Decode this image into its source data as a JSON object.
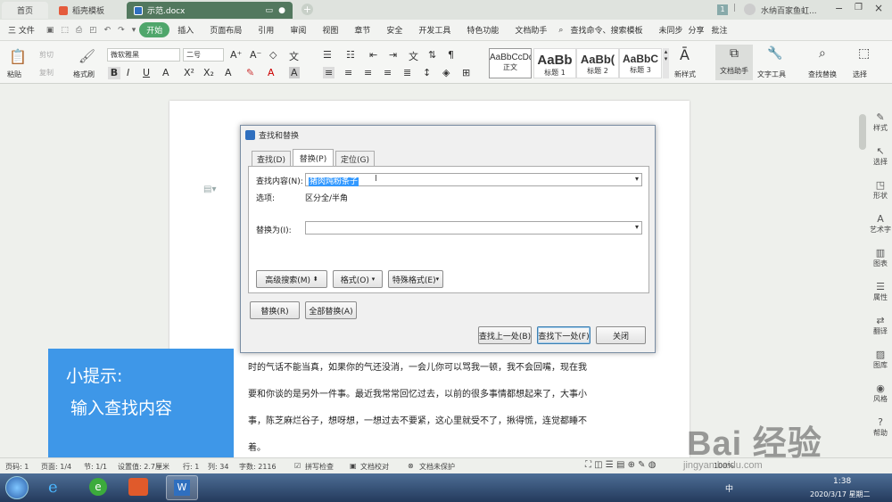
{
  "titlebar": {
    "tabs": [
      {
        "label": "首页"
      },
      {
        "label": "稻壳模板"
      },
      {
        "label": "示范.docx"
      }
    ],
    "user": "水纳百家鱼虹...",
    "badge": "1"
  },
  "menubar": {
    "file": "三 文件",
    "items": [
      "开始",
      "插入",
      "页面布局",
      "引用",
      "审阅",
      "视图",
      "章节",
      "安全",
      "开发工具",
      "特色功能",
      "文档助手"
    ],
    "active": "开始",
    "search": "查找命令、搜索模板",
    "sync": "未同步",
    "share": "分享",
    "comment": "批注"
  },
  "ribbon": {
    "paste": "粘贴",
    "cut": "剪切",
    "copy": "复制",
    "format_painter": "格式刷",
    "font_name": "微软雅黑",
    "font_size": "二号",
    "styles": [
      {
        "sample": "AaBbCcDd",
        "name": "正文"
      },
      {
        "sample": "AaBb",
        "name": "标题 1"
      },
      {
        "sample": "AaBb(",
        "name": "标题 2"
      },
      {
        "sample": "AaBbC",
        "name": "标题 3"
      }
    ],
    "new_style": "新样式",
    "doc_assistant": "文档助手",
    "text_tools": "文字工具",
    "find_replace": "查找替换",
    "select": "选择"
  },
  "dialog": {
    "title": "查找和替换",
    "tabs": [
      "查找(D)",
      "替换(P)",
      "定位(G)"
    ],
    "selected_tab": "替换(P)",
    "find_label": "查找内容(N):",
    "find_value": "猪肉炖粉条子",
    "options_label": "选项:",
    "options_value": "区分全/半角",
    "replace_label": "替换为(I):",
    "replace_value": "",
    "advanced": "高级搜索(M)",
    "format": "格式(O)",
    "special": "特殊格式(E)",
    "replace_btn": "替换(R)",
    "replace_all": "全部替换(A)",
    "find_prev": "查找上一处(B)",
    "find_next": "查找下一处(F)",
    "close": "关闭"
  },
  "document": {
    "lines": [
      "时的气话不能当真，如果你的气还没消，一会儿你可以骂我一顿，我不会回嘴，现在我",
      "要和你谈的是另外一件事。最近我常常回忆过去，以前的很多事情都想起来了，大事小",
      "事，陈芝麻烂谷子，想呀想，一想过去不要紧，这心里就受不了，揪得慌，连觉都睡不",
      "着。"
    ]
  },
  "tip": {
    "title": "小提示:",
    "body": "输入查找内容"
  },
  "rail": [
    "样式",
    "选择",
    "形状",
    "艺术字",
    "图表",
    "属性",
    "翻译",
    "图库",
    "风格",
    "帮助"
  ],
  "status": {
    "page": "页码: 1",
    "pages": "页面: 1/4",
    "section": "节: 1/1",
    "position": "设置值: 2.7厘米",
    "row": "行: 1",
    "col": "列: 34",
    "words": "字数: 2116",
    "spell": "拼写检查",
    "proof": "文档校对",
    "protect": "文档未保护",
    "zoom": "100%"
  },
  "taskbar": {
    "time": "1:38",
    "date": "2020/3/17 星期二",
    "ime": "中"
  },
  "watermark": {
    "brand": "Bai 经验",
    "url": "jingyan.baidu.com"
  },
  "colors": {
    "accent": "#4fa66b",
    "doc_tab": "#52785e",
    "tip_bg": "#3e97e8",
    "selection": "#3399ff"
  }
}
